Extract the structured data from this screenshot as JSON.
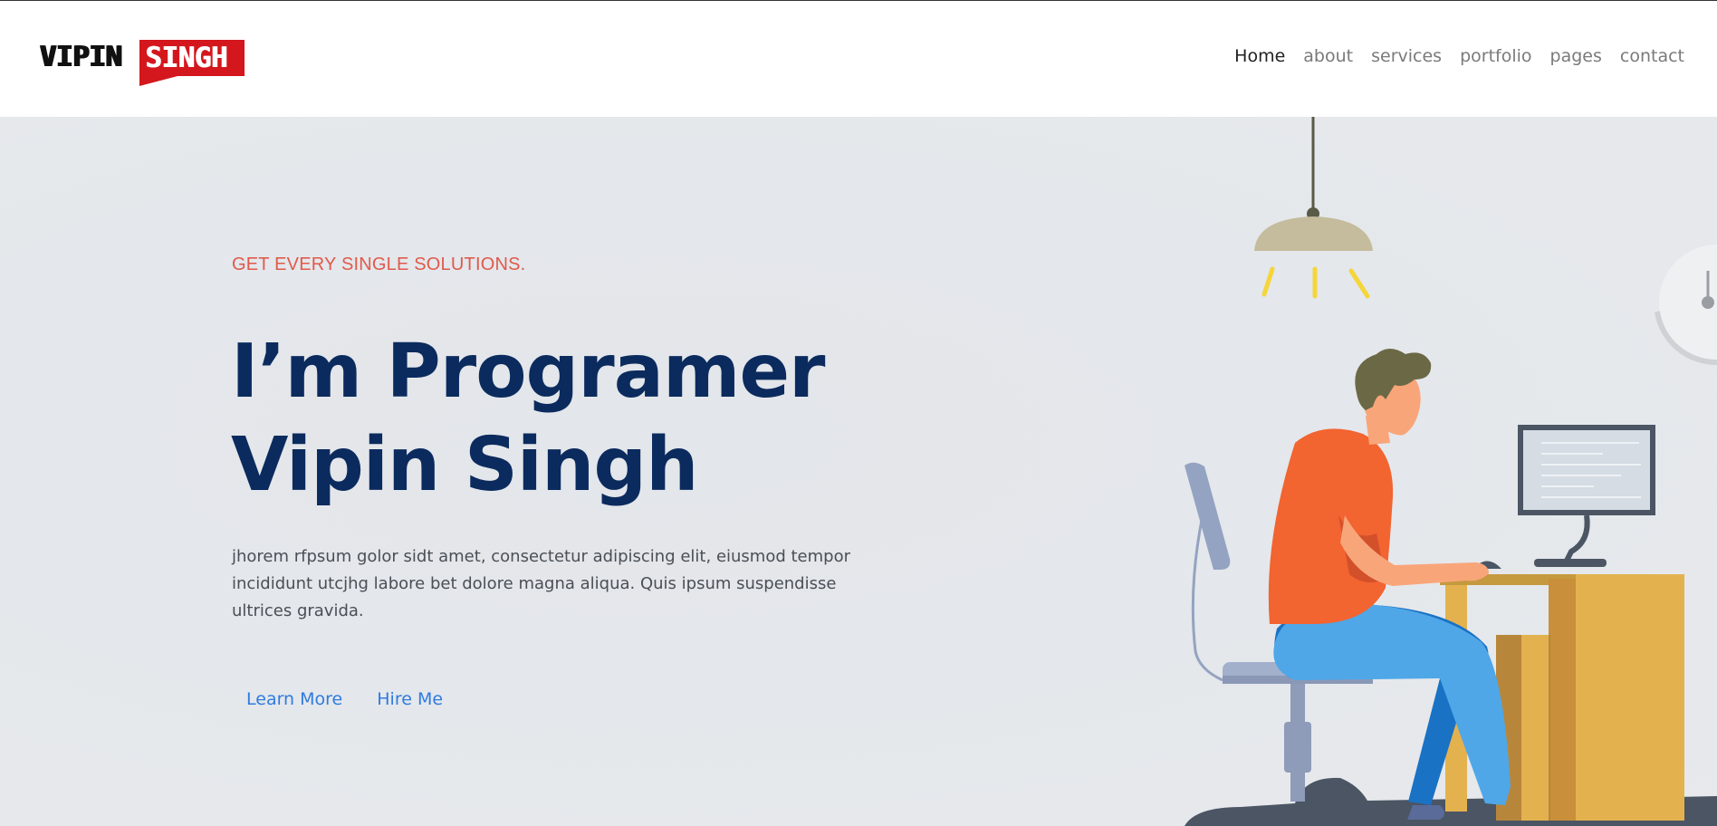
{
  "logo": {
    "part1": "VIPIN",
    "part2": "SINGH"
  },
  "nav": {
    "items": [
      {
        "label": "Home",
        "active": true
      },
      {
        "label": "about",
        "active": false
      },
      {
        "label": "services",
        "active": false
      },
      {
        "label": "portfolio",
        "active": false
      },
      {
        "label": "pages",
        "active": false
      },
      {
        "label": "contact",
        "active": false
      }
    ]
  },
  "hero": {
    "tagline": "GET EVERY SINGLE SOLUTIONS.",
    "headline_line1": "I’m Programer",
    "headline_line2": "Vipin Singh",
    "description": "jhorem rfpsum golor sidt amet, consectetur adipiscing elit, eiusmod tempor incididunt utcjhg labore bet dolore magna aliqua. Quis ipsum suspendisse ultrices gravida.",
    "buttons": {
      "learn_more": "Learn More",
      "hire_me": "Hire Me"
    }
  },
  "colors": {
    "accent_red": "#d4171d",
    "headline_navy": "#0b2b5e",
    "tagline_red": "#e05a4c",
    "link_blue": "#2f7be0"
  },
  "illustration": {
    "subject": "programmer-at-desk-illustration"
  }
}
